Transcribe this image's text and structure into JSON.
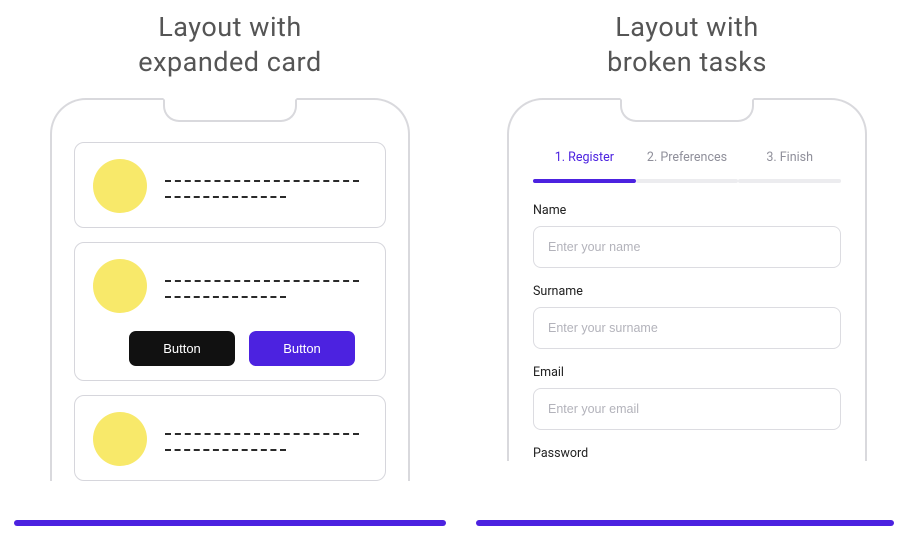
{
  "colors": {
    "accent": "#4c22e0",
    "avatar": "#f8e96a",
    "buttonDark": "#111111"
  },
  "left": {
    "title_line1": "Layout with",
    "title_line2": "expanded card",
    "button1_label": "Button",
    "button2_label": "Button"
  },
  "right": {
    "title_line1": "Layout with",
    "title_line2": "broken tasks",
    "steps": [
      {
        "label": "1. Register",
        "active": true
      },
      {
        "label": "2. Preferences",
        "active": false
      },
      {
        "label": "3. Finish",
        "active": false
      }
    ],
    "fields": {
      "name": {
        "label": "Name",
        "placeholder": "Enter your name"
      },
      "surname": {
        "label": "Surname",
        "placeholder": "Enter your surname"
      },
      "email": {
        "label": "Email",
        "placeholder": "Enter your email"
      },
      "password": {
        "label": "Password",
        "placeholder": ""
      }
    }
  }
}
